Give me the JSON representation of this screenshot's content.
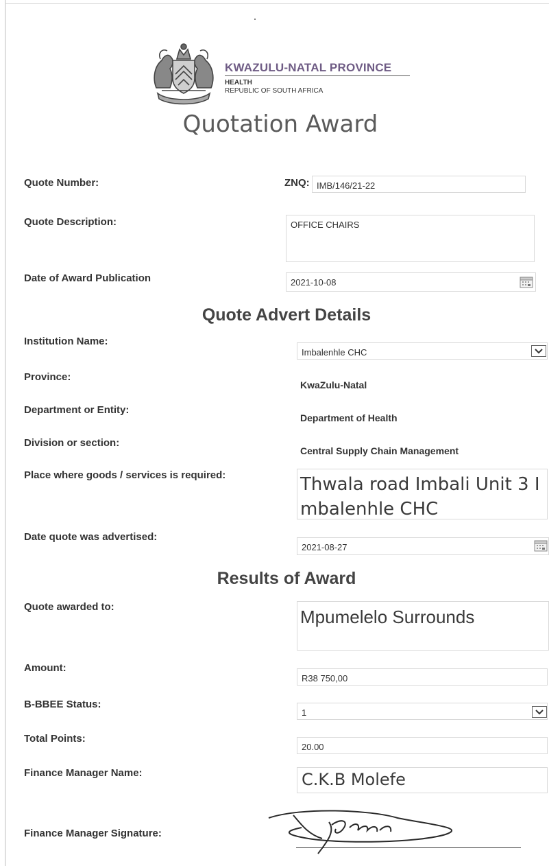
{
  "header": {
    "province_title": "KWAZULU-NATAL PROVINCE",
    "department": "HEALTH",
    "republic": "REPUBLIC OF SOUTH AFRICA",
    "crest_icon": "coat-of-arms-icon"
  },
  "title": "Quotation Award",
  "quote": {
    "number_label": "Quote Number:",
    "number_prefix": "ZNQ:",
    "number_value": "IMB/146/21-22",
    "description_label": "Quote Description:",
    "description_value": "OFFICE CHAIRS",
    "publication_label": "Date of Award Publication",
    "publication_value": "2021-10-08"
  },
  "advert": {
    "heading": "Quote Advert Details",
    "institution_label": "Institution Name:",
    "institution_value": "Imbalenhle CHC",
    "province_label": "Province:",
    "province_value": "KwaZulu-Natal",
    "department_label": "Department or Entity:",
    "department_value": "Department of Health",
    "division_label": "Division or section:",
    "division_value": "Central Supply Chain Management",
    "place_label": "Place where goods /  services is required:",
    "place_value": "Thwala road Imbali Unit 3 Imbalenhle CHC",
    "advertised_label": "Date quote was advertised:",
    "advertised_value": "2021-08-27"
  },
  "results": {
    "heading": "Results of Award",
    "awarded_label": "Quote awarded to:",
    "awarded_value": "Mpumelelo Surrounds",
    "amount_label": "Amount:",
    "amount_value": "R38 750,00",
    "bbbee_label": "B-BBEE Status:",
    "bbbee_value": "1",
    "points_label": "Total Points:",
    "points_value": "20.00",
    "fm_name_label": "Finance Manager Name:",
    "fm_name_value": "C.K.B Molefe",
    "fm_signature_label": "Finance Manager Signature:"
  }
}
